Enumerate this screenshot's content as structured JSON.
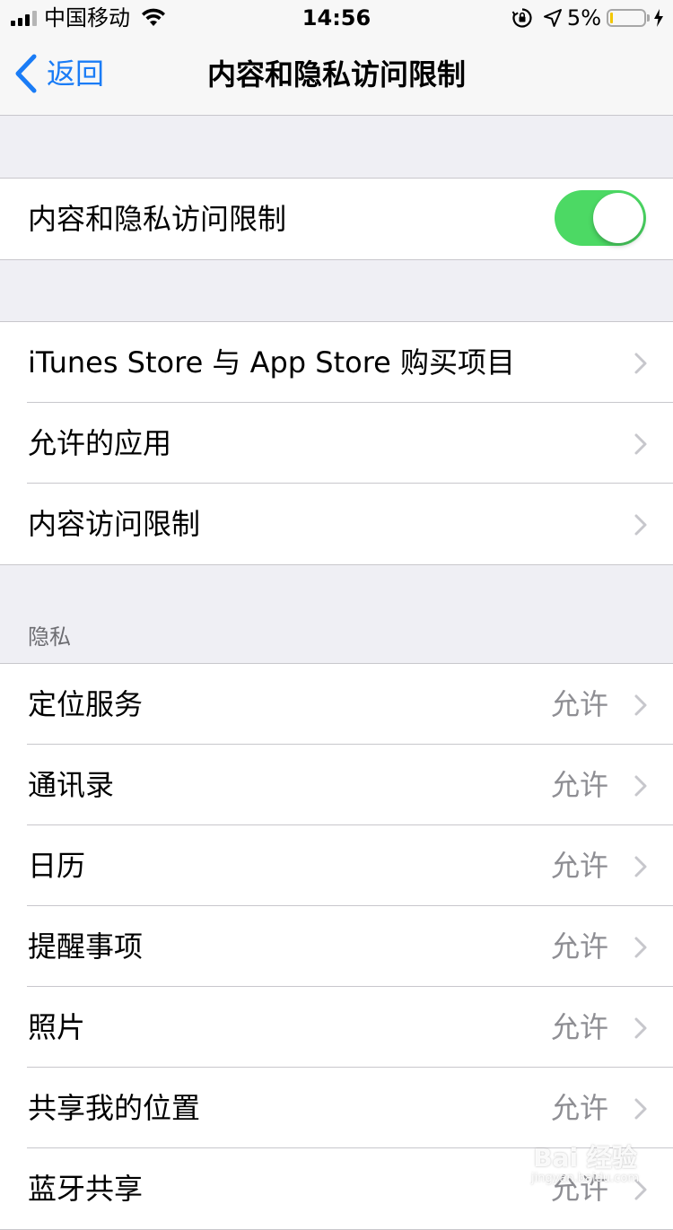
{
  "status_bar": {
    "carrier": "中国移动",
    "time": "14:56",
    "battery_percent": "5%",
    "battery_level": 0.05,
    "icons": [
      "signal-icon",
      "wifi-icon",
      "orientation-lock-icon",
      "location-icon",
      "battery-icon",
      "charging-icon"
    ]
  },
  "nav": {
    "back_label": "返回",
    "title": "内容和隐私访问限制"
  },
  "toggle_group": {
    "label": "内容和隐私访问限制",
    "toggle_on": true,
    "toggle_color": "#4cd964"
  },
  "menu_group": {
    "items": [
      {
        "label": "iTunes Store 与 App Store 购买项目"
      },
      {
        "label": "允许的应用"
      },
      {
        "label": "内容访问限制"
      }
    ]
  },
  "privacy": {
    "header": "隐私",
    "items": [
      {
        "label": "定位服务",
        "value": "允许"
      },
      {
        "label": "通讯录",
        "value": "允许"
      },
      {
        "label": "日历",
        "value": "允许"
      },
      {
        "label": "提醒事项",
        "value": "允许"
      },
      {
        "label": "照片",
        "value": "允许"
      },
      {
        "label": "共享我的位置",
        "value": "允许"
      },
      {
        "label": "蓝牙共享",
        "value": "允许"
      }
    ]
  },
  "watermark": {
    "main": "Bai 经验",
    "sub": "jingyan.baidu.com"
  },
  "colors": {
    "accent": "#1a7cf6",
    "background": "#efeff4",
    "separator": "#c8c7cc",
    "detail_text": "#8e8e93"
  }
}
